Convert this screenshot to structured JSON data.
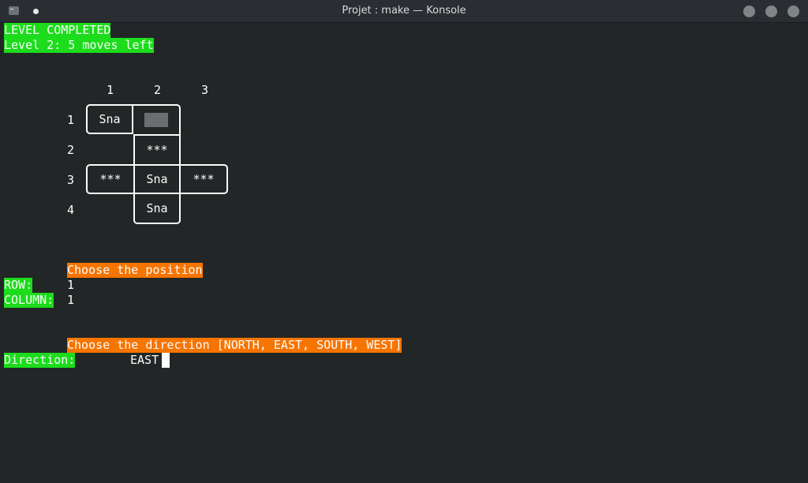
{
  "window": {
    "title": "Projet : make — Konsole",
    "app_icon": "terminal-icon",
    "buttons": [
      "minimize-button",
      "maximize-button",
      "close-button"
    ]
  },
  "status": {
    "line1": "LEVEL COMPLETED",
    "line2": "Level 2: 5 moves left"
  },
  "grid": {
    "col_headers": [
      "1",
      "2",
      "3"
    ],
    "row_headers": [
      "1",
      "2",
      "3",
      "4"
    ],
    "cells": {
      "r1c1": "Sna",
      "r1c2": "",
      "r2c2": "***",
      "r3c1": "***",
      "r3c2": "Sna",
      "r3c3": "***",
      "r4c2": "Sna"
    }
  },
  "position_prompt": {
    "title": "Choose the position",
    "row_label": "ROW:",
    "row_value": "1",
    "column_label": "COLUMN:",
    "column_value": "1"
  },
  "direction_prompt": {
    "title": "Choose the direction [NORTH, EAST, SOUTH, WEST]",
    "label": "Direction:",
    "value": "EAST"
  },
  "colors": {
    "terminal_bg": "#232627",
    "green": "#1cdc1c",
    "orange": "#f67400",
    "text": "#fcfcfc"
  }
}
